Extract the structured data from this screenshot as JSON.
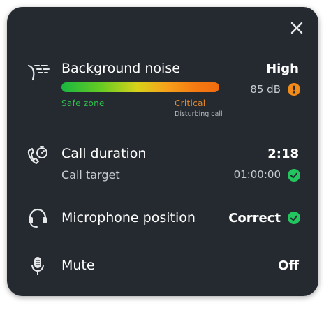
{
  "colors": {
    "panel_bg": "#252a30",
    "safe_green": "#2dbf4c",
    "critical_orange": "#e88a2a",
    "check_green": "#22c55e",
    "warning_orange": "#f28c18"
  },
  "rows": {
    "noise": {
      "icon": "noise-icon",
      "label": "Background noise",
      "value": "High",
      "level": "85 dB",
      "status_icon": "warning-icon",
      "safe_label": "Safe zone",
      "critical_label": "Critical",
      "critical_note": "Disturbing call"
    },
    "duration": {
      "icon": "phone-timer-icon",
      "label": "Call duration",
      "value": "2:18",
      "target_label": "Call target",
      "target_value": "01:00:00",
      "status_icon": "check-icon"
    },
    "microphone": {
      "icon": "headset-icon",
      "label": "Microphone position",
      "value": "Correct",
      "status_icon": "check-icon"
    },
    "mute": {
      "icon": "microphone-icon",
      "label": "Mute",
      "value": "Off"
    }
  }
}
